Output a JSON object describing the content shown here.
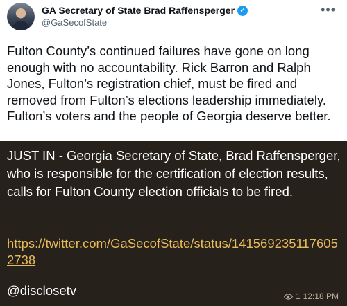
{
  "tweet": {
    "display_name": "GA Secretary of State Brad Raffensperger",
    "handle": "@GaSecofState",
    "more_label": "•••",
    "body": "Fulton County’s continued failures have gone on long enough with no accountability. Rick Barron and Ralph Jones, Fulton’s registration chief, must be fired and removed from Fulton’s elections leadership immediately. Fulton’s voters and the people of Georgia deserve better."
  },
  "message": {
    "caption": "JUST IN - Georgia Secretary of State, Brad Raffensperger, who is responsible for the certification of election results, calls for Fulton County election officials to be fired.",
    "link": "https://twitter.com/GaSecofState/status/1415692351176052738",
    "signature": "@disclosetv",
    "views": "1",
    "time": "12:18 PM"
  },
  "icons": {
    "verified": "verified-badge-icon",
    "views": "eye-icon",
    "more": "more-options-icon"
  },
  "colors": {
    "link": "#e8b95a",
    "verified": "#1d9bf0",
    "background": "#26221b"
  }
}
